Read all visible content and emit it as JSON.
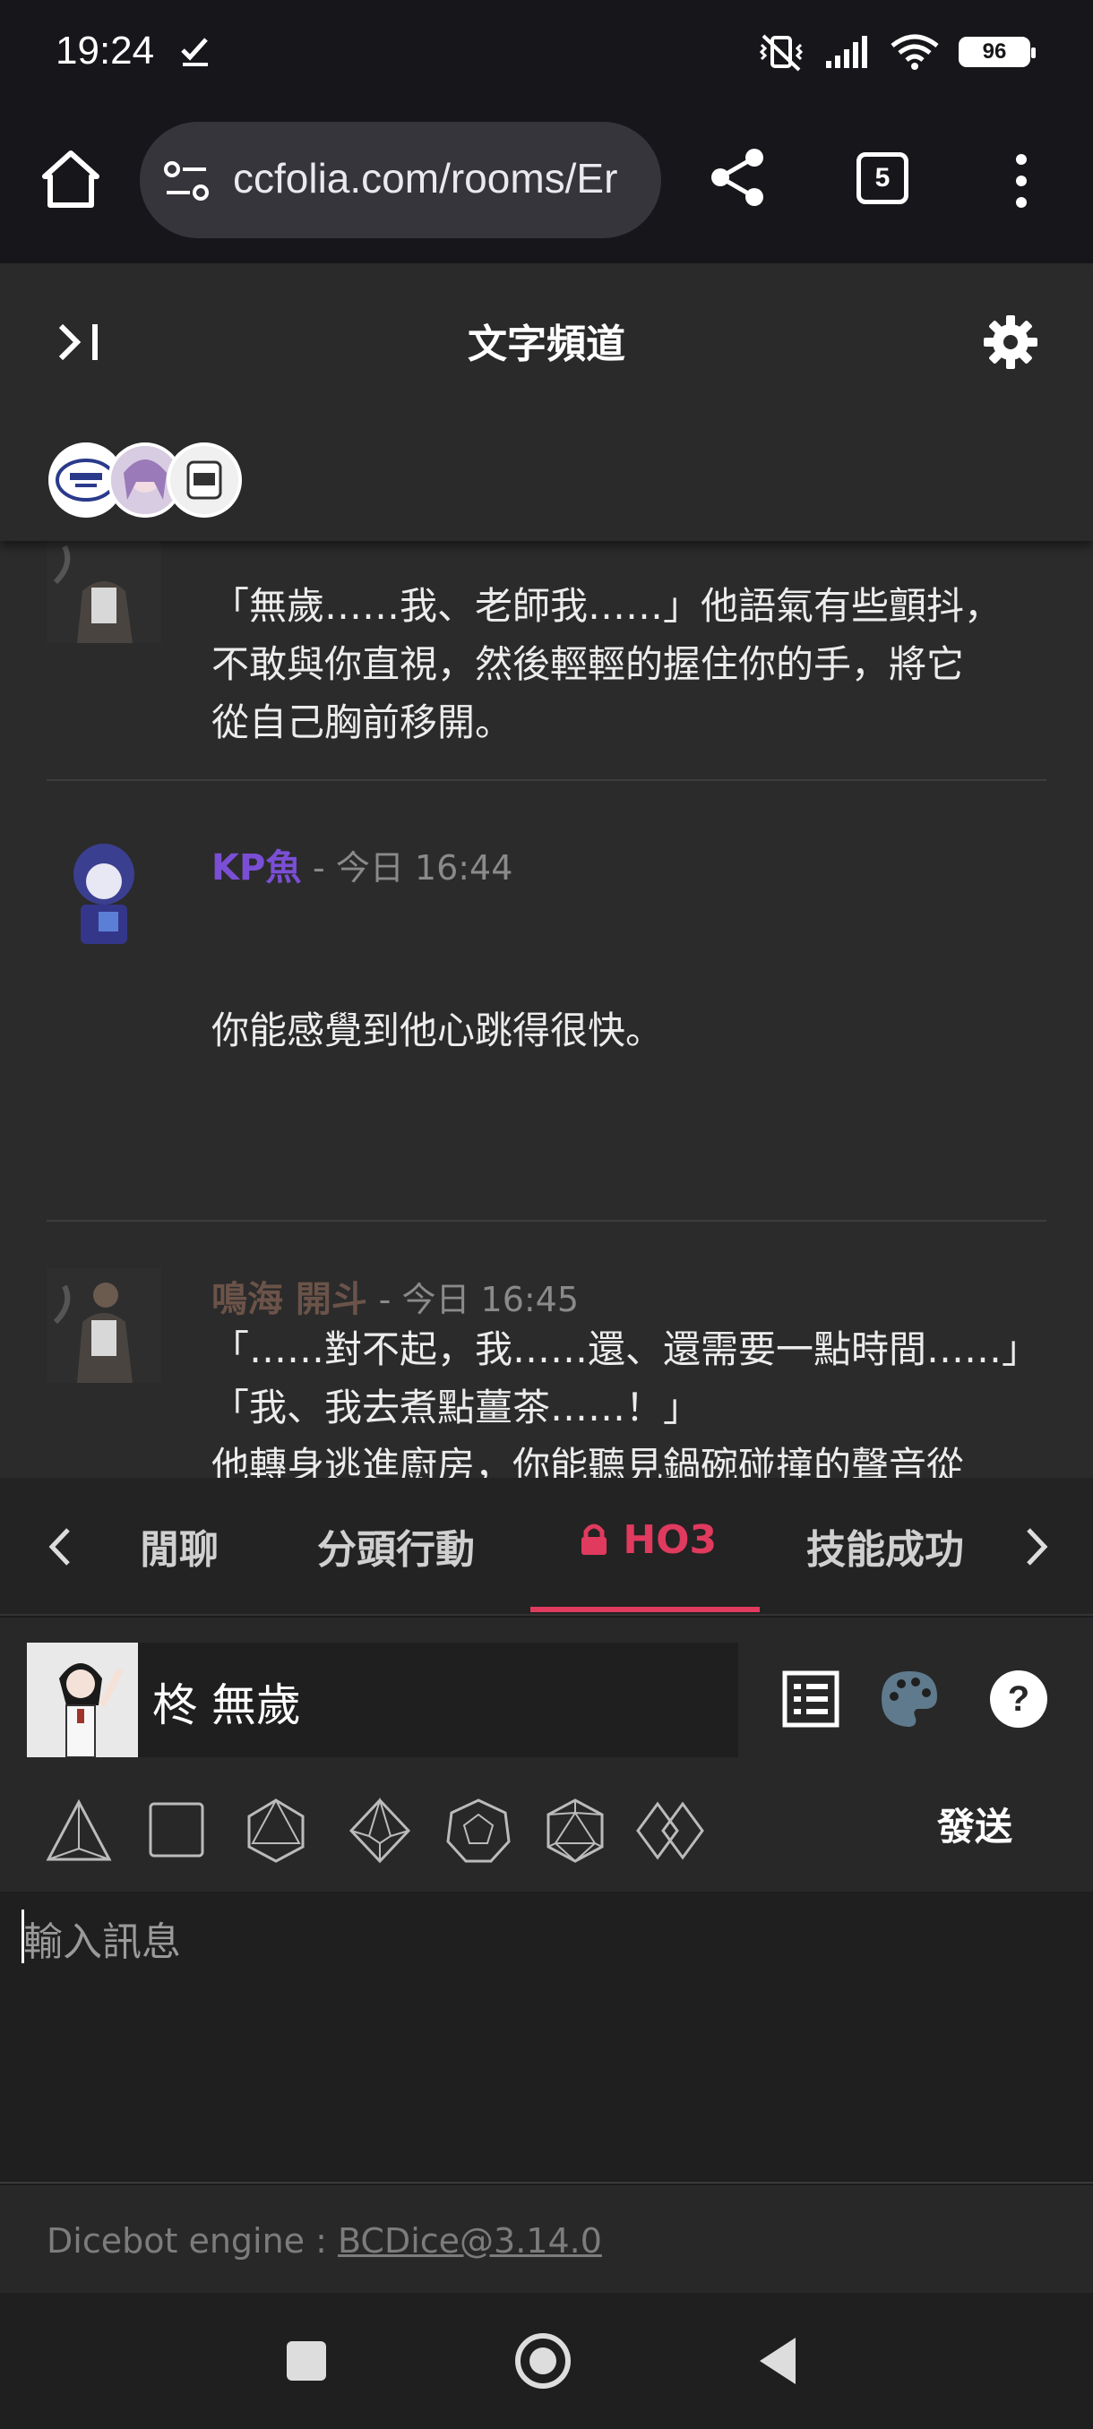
{
  "status_bar": {
    "time": "19:24",
    "battery": "96"
  },
  "browser": {
    "url": "ccfolia.com/rooms/Er",
    "tab_count": "5"
  },
  "chat": {
    "title": "文字頻道"
  },
  "messages": [
    {
      "name": "",
      "time": "",
      "name_color": "#8a6a5a",
      "lines": [
        "「無歲……我、老師我……」他語氣有些顫抖，",
        "不敢與你直視，然後輕輕的握住你的手，將它",
        "從自己胸前移開。"
      ]
    },
    {
      "name": "KP魚",
      "time": "- 今日 16:44",
      "name_color": "#7a4fd6",
      "lines": [
        "你能感覺到他心跳得很快。"
      ]
    },
    {
      "name": "鳴海 開斗",
      "time": "- 今日 16:45",
      "name_color": "#6b5349",
      "lines": [
        "「……對不起，我……還、還需要一點時間……」",
        "「我、我去煮點薑茶……！」",
        "他轉身逃進廚房，你能聽見鍋碗碰撞的聲音從"
      ]
    }
  ],
  "tabs": [
    {
      "label": "閒聊"
    },
    {
      "label": "分頭行動"
    },
    {
      "label": "HO3",
      "active": true,
      "locked": true
    },
    {
      "label": "技能成功"
    }
  ],
  "composer": {
    "character_name": "柊 無歲",
    "send_label": "發送",
    "placeholder": "輸入訊息"
  },
  "footer": {
    "prefix": "Dicebot engine : ",
    "link": "BCDice@3.14.0"
  },
  "colors": {
    "accent": "#e03a5e",
    "background": "#2b2b2b",
    "header": "#2a2a2a"
  }
}
